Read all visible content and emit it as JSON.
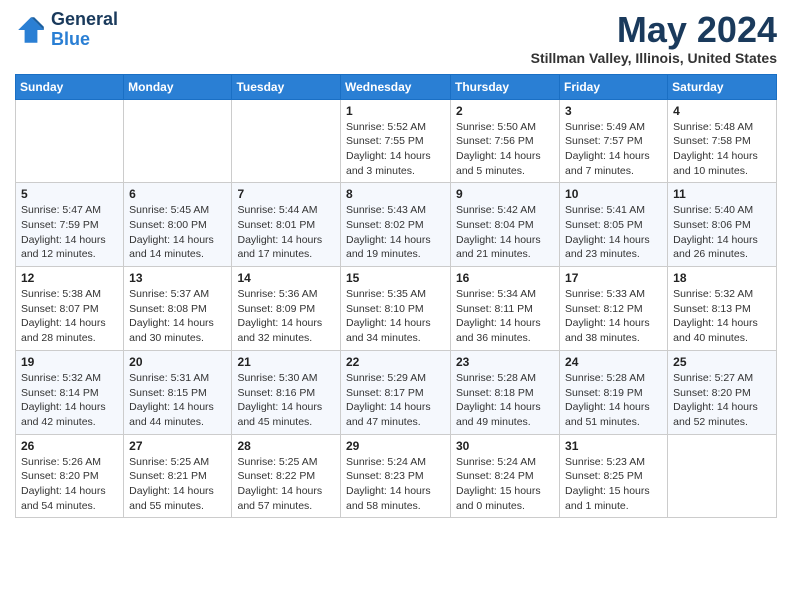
{
  "header": {
    "logo_general": "General",
    "logo_blue": "Blue",
    "month_title": "May 2024",
    "location": "Stillman Valley, Illinois, United States"
  },
  "days_of_week": [
    "Sunday",
    "Monday",
    "Tuesday",
    "Wednesday",
    "Thursday",
    "Friday",
    "Saturday"
  ],
  "weeks": [
    [
      {
        "day": "",
        "info": ""
      },
      {
        "day": "",
        "info": ""
      },
      {
        "day": "",
        "info": ""
      },
      {
        "day": "1",
        "info": "Sunrise: 5:52 AM\nSunset: 7:55 PM\nDaylight: 14 hours\nand 3 minutes."
      },
      {
        "day": "2",
        "info": "Sunrise: 5:50 AM\nSunset: 7:56 PM\nDaylight: 14 hours\nand 5 minutes."
      },
      {
        "day": "3",
        "info": "Sunrise: 5:49 AM\nSunset: 7:57 PM\nDaylight: 14 hours\nand 7 minutes."
      },
      {
        "day": "4",
        "info": "Sunrise: 5:48 AM\nSunset: 7:58 PM\nDaylight: 14 hours\nand 10 minutes."
      }
    ],
    [
      {
        "day": "5",
        "info": "Sunrise: 5:47 AM\nSunset: 7:59 PM\nDaylight: 14 hours\nand 12 minutes."
      },
      {
        "day": "6",
        "info": "Sunrise: 5:45 AM\nSunset: 8:00 PM\nDaylight: 14 hours\nand 14 minutes."
      },
      {
        "day": "7",
        "info": "Sunrise: 5:44 AM\nSunset: 8:01 PM\nDaylight: 14 hours\nand 17 minutes."
      },
      {
        "day": "8",
        "info": "Sunrise: 5:43 AM\nSunset: 8:02 PM\nDaylight: 14 hours\nand 19 minutes."
      },
      {
        "day": "9",
        "info": "Sunrise: 5:42 AM\nSunset: 8:04 PM\nDaylight: 14 hours\nand 21 minutes."
      },
      {
        "day": "10",
        "info": "Sunrise: 5:41 AM\nSunset: 8:05 PM\nDaylight: 14 hours\nand 23 minutes."
      },
      {
        "day": "11",
        "info": "Sunrise: 5:40 AM\nSunset: 8:06 PM\nDaylight: 14 hours\nand 26 minutes."
      }
    ],
    [
      {
        "day": "12",
        "info": "Sunrise: 5:38 AM\nSunset: 8:07 PM\nDaylight: 14 hours\nand 28 minutes."
      },
      {
        "day": "13",
        "info": "Sunrise: 5:37 AM\nSunset: 8:08 PM\nDaylight: 14 hours\nand 30 minutes."
      },
      {
        "day": "14",
        "info": "Sunrise: 5:36 AM\nSunset: 8:09 PM\nDaylight: 14 hours\nand 32 minutes."
      },
      {
        "day": "15",
        "info": "Sunrise: 5:35 AM\nSunset: 8:10 PM\nDaylight: 14 hours\nand 34 minutes."
      },
      {
        "day": "16",
        "info": "Sunrise: 5:34 AM\nSunset: 8:11 PM\nDaylight: 14 hours\nand 36 minutes."
      },
      {
        "day": "17",
        "info": "Sunrise: 5:33 AM\nSunset: 8:12 PM\nDaylight: 14 hours\nand 38 minutes."
      },
      {
        "day": "18",
        "info": "Sunrise: 5:32 AM\nSunset: 8:13 PM\nDaylight: 14 hours\nand 40 minutes."
      }
    ],
    [
      {
        "day": "19",
        "info": "Sunrise: 5:32 AM\nSunset: 8:14 PM\nDaylight: 14 hours\nand 42 minutes."
      },
      {
        "day": "20",
        "info": "Sunrise: 5:31 AM\nSunset: 8:15 PM\nDaylight: 14 hours\nand 44 minutes."
      },
      {
        "day": "21",
        "info": "Sunrise: 5:30 AM\nSunset: 8:16 PM\nDaylight: 14 hours\nand 45 minutes."
      },
      {
        "day": "22",
        "info": "Sunrise: 5:29 AM\nSunset: 8:17 PM\nDaylight: 14 hours\nand 47 minutes."
      },
      {
        "day": "23",
        "info": "Sunrise: 5:28 AM\nSunset: 8:18 PM\nDaylight: 14 hours\nand 49 minutes."
      },
      {
        "day": "24",
        "info": "Sunrise: 5:28 AM\nSunset: 8:19 PM\nDaylight: 14 hours\nand 51 minutes."
      },
      {
        "day": "25",
        "info": "Sunrise: 5:27 AM\nSunset: 8:20 PM\nDaylight: 14 hours\nand 52 minutes."
      }
    ],
    [
      {
        "day": "26",
        "info": "Sunrise: 5:26 AM\nSunset: 8:20 PM\nDaylight: 14 hours\nand 54 minutes."
      },
      {
        "day": "27",
        "info": "Sunrise: 5:25 AM\nSunset: 8:21 PM\nDaylight: 14 hours\nand 55 minutes."
      },
      {
        "day": "28",
        "info": "Sunrise: 5:25 AM\nSunset: 8:22 PM\nDaylight: 14 hours\nand 57 minutes."
      },
      {
        "day": "29",
        "info": "Sunrise: 5:24 AM\nSunset: 8:23 PM\nDaylight: 14 hours\nand 58 minutes."
      },
      {
        "day": "30",
        "info": "Sunrise: 5:24 AM\nSunset: 8:24 PM\nDaylight: 15 hours\nand 0 minutes."
      },
      {
        "day": "31",
        "info": "Sunrise: 5:23 AM\nSunset: 8:25 PM\nDaylight: 15 hours\nand 1 minute."
      },
      {
        "day": "",
        "info": ""
      }
    ]
  ]
}
